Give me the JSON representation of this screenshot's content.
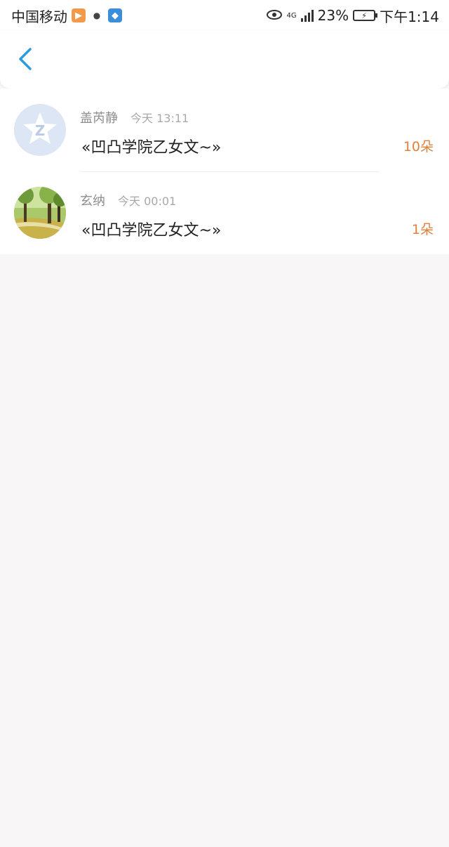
{
  "status_bar": {
    "carrier": "中国移动",
    "network": "4G",
    "battery": "23%",
    "time": "下午1:14"
  },
  "header": {
    "back_icon": "chevron-left-icon",
    "accent": "#2a9be0"
  },
  "list": [
    {
      "name": "盖芮静",
      "time": "今天 13:11",
      "title": "«凹凸学院乙女文~»",
      "count": "10朵",
      "avatar": "default-star-avatar"
    },
    {
      "name": "玄纳",
      "time": "今天 00:01",
      "title": "«凹凸学院乙女文~»",
      "count": "1朵",
      "avatar": "park-photo-avatar"
    }
  ],
  "colors": {
    "count": "#e0803c",
    "background": "#f8f6f7"
  }
}
